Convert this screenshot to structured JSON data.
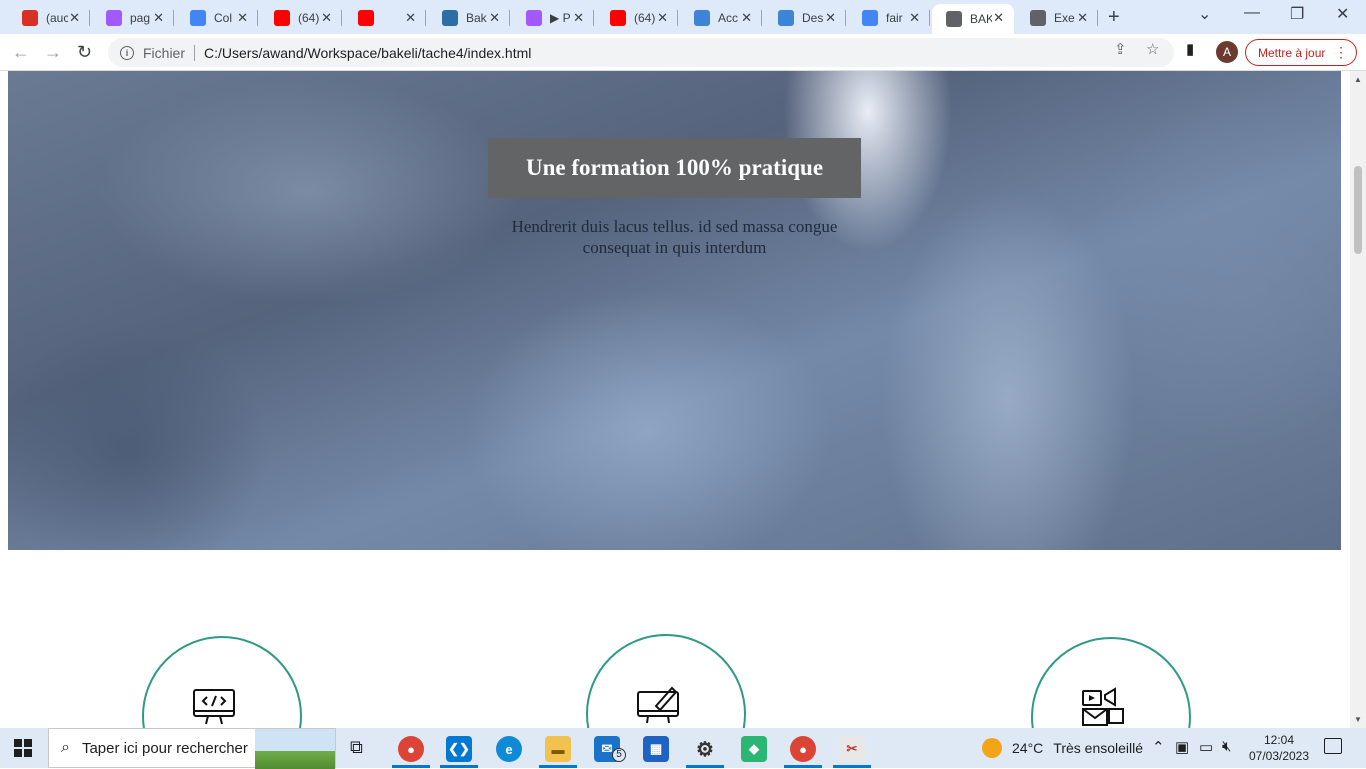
{
  "browser": {
    "tabs": [
      {
        "title": "(auc",
        "icon": "gmail-icon",
        "color": "#d93025"
      },
      {
        "title": "pag",
        "icon": "figma-icon",
        "color": "#a259ff"
      },
      {
        "title": "Col",
        "icon": "google-icon",
        "color": "#4285f4"
      },
      {
        "title": "(64)",
        "icon": "youtube-icon",
        "color": "#ff0000"
      },
      {
        "title": "",
        "icon": "youtube-icon",
        "color": "#ff0000"
      },
      {
        "title": "Bak",
        "icon": "bakeli-icon",
        "color": "#2a6ea8"
      },
      {
        "title": "▶ P",
        "icon": "figma-icon",
        "color": "#a259ff"
      },
      {
        "title": "(64)",
        "icon": "youtube-icon",
        "color": "#ff0000"
      },
      {
        "title": "Acc",
        "icon": "canva-icon",
        "color": "#3d83d8"
      },
      {
        "title": "Des",
        "icon": "canva-icon",
        "color": "#3d83d8"
      },
      {
        "title": "fair",
        "icon": "google-icon",
        "color": "#4285f4"
      },
      {
        "title": "BAK",
        "icon": "globe-icon",
        "color": "#5f6368"
      },
      {
        "title": "Exe",
        "icon": "globe-icon",
        "color": "#5f6368"
      }
    ],
    "active_tab": 11,
    "address": {
      "scheme_label": "Fichier",
      "url": "C:/Users/awand/Workspace/bakeli/tache4/index.html"
    },
    "profile_initial": "A",
    "update_label": "Mettre à jour"
  },
  "page": {
    "hero_title": "Une formation 100% pratique",
    "hero_subtitle": "Hendrerit duis lacus tellus. id sed massa congue consequat in quis interdum",
    "features": [
      {
        "icon": "code-monitor-icon"
      },
      {
        "icon": "design-tablet-icon"
      },
      {
        "icon": "media-marketing-icon"
      }
    ]
  },
  "taskbar": {
    "search_placeholder": "Taper ici pour rechercher",
    "mail_badge": "5",
    "weather": {
      "temp": "24°C",
      "label": "Très ensoleillé"
    },
    "time": "12:04",
    "date": "07/03/2023"
  }
}
